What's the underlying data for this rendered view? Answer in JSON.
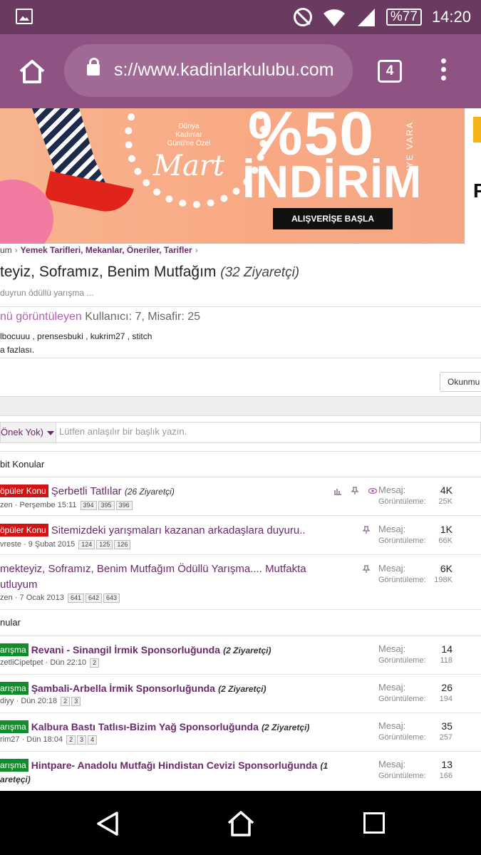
{
  "status_bar": {
    "battery": "%77",
    "time": "14:20"
  },
  "browser": {
    "url": "s://www.kadinlarkulubu.com",
    "tab_count": "4"
  },
  "banner": {
    "mart_line1": "Dünya",
    "mart_line2": "Kadınlar",
    "mart_line3": "Günü'ne Özel",
    "mart_script": "Mart",
    "percent": "%50",
    "ye_var": "'YE VARA",
    "headline": "İNDİRİM",
    "cta": "ALIŞVERİŞE BAŞLA",
    "edge_letter": "F"
  },
  "breadcrumb": {
    "prev": "um",
    "current": "Yemek Tarifleri, Mekanlar, Öneriler, Tarifler",
    "sep": "›"
  },
  "page": {
    "title": "teyiz, Soframız, Benim Mutfağım",
    "visitors": "(32 Ziyaretçi)",
    "description": "duyrun ödüllü yarışma ..."
  },
  "viewing": {
    "label": "nü görüntüleyen",
    "counts": "Kullanıcı: 7, Misafir: 25",
    "users": "lbocuuu , prensesbuki , kukrim27 , stitch",
    "more": "a fazlası."
  },
  "actions": {
    "mark_read": "Okunmu"
  },
  "new_thread": {
    "prefix": "Önek Yok)",
    "placeholder": "Lütfen anlaşılır bir başlık yazın."
  },
  "sections": {
    "sticky": "bit Konular",
    "normal": "nular"
  },
  "stat_labels": {
    "messages": "Mesaj:",
    "views": "Görüntüleme:"
  },
  "sticky_threads": [
    {
      "badge": "öpüler Konu",
      "title": "Şerbetli Tatlılar",
      "visitors": "(26 Ziyaretçi)",
      "author": "zen",
      "date": "Perşembe 15:11",
      "pages": [
        "394",
        "395",
        "396"
      ],
      "messages": "4K",
      "views": "25K",
      "icons": [
        "chart-icon",
        "pin-icon",
        "watch-icon"
      ]
    },
    {
      "badge": "öpüler Konu",
      "title": "Sitemizdeki yarışmaları kazanan arkadaşlara duyuru..",
      "visitors": "",
      "author": "vreste",
      "date": "9 Şubat 2015",
      "pages": [
        "124",
        "125",
        "126"
      ],
      "messages": "1K",
      "views": "66K",
      "icons": [
        "pin-icon"
      ]
    },
    {
      "badge": "",
      "title": "mekteyiz, Soframız, Benim Mutfağım Ödüllü Yarışma.... Mutfakta",
      "title2": "utluyum",
      "visitors": "",
      "author": "zen",
      "date": "7 Ocak 2013",
      "pages": [
        "641",
        "642",
        "643"
      ],
      "messages": "6K",
      "views": "198K",
      "icons": [
        "pin-icon"
      ]
    }
  ],
  "threads": [
    {
      "badge": "arışma",
      "title": "Revani - Sinangil İrmik Sponsorluğunda",
      "visitors": "(2 Ziyaretçi)",
      "author": "zetliCipetpet",
      "date": "Dün 22:10",
      "pages": [
        "2"
      ],
      "messages": "14",
      "views": "118"
    },
    {
      "badge": "arışma",
      "title": "Şambali-Arbella İrmik Sponsorluğunda",
      "visitors": "(2 Ziyaretçi)",
      "author": "diyy",
      "date": "Dün 20:18",
      "pages": [
        "2",
        "3"
      ],
      "messages": "26",
      "views": "194"
    },
    {
      "badge": "arışma",
      "title": "Kalbura Bastı Tatlısı-Bizim Yağ Sponsorluğunda",
      "visitors": "(2 Ziyaretçi)",
      "author": "rim27",
      "date": "Dün 18:04",
      "pages": [
        "2",
        "3",
        "4"
      ],
      "messages": "35",
      "views": "257"
    },
    {
      "badge": "arışma",
      "title": "Hintpare- Anadolu Mutfağı Hindistan Cevizi Sponsorluğunda",
      "visitors": "(1",
      "visitors2": "aretȩçi)",
      "author": "",
      "date": "",
      "pages": [],
      "messages": "13",
      "views": "166"
    }
  ],
  "colors": {
    "status_bar": "#6b3a61",
    "browser_bar": "#8e5283",
    "accent": "#6b2a6a",
    "badge_red": "#d31414",
    "badge_green": "#118c2a"
  }
}
